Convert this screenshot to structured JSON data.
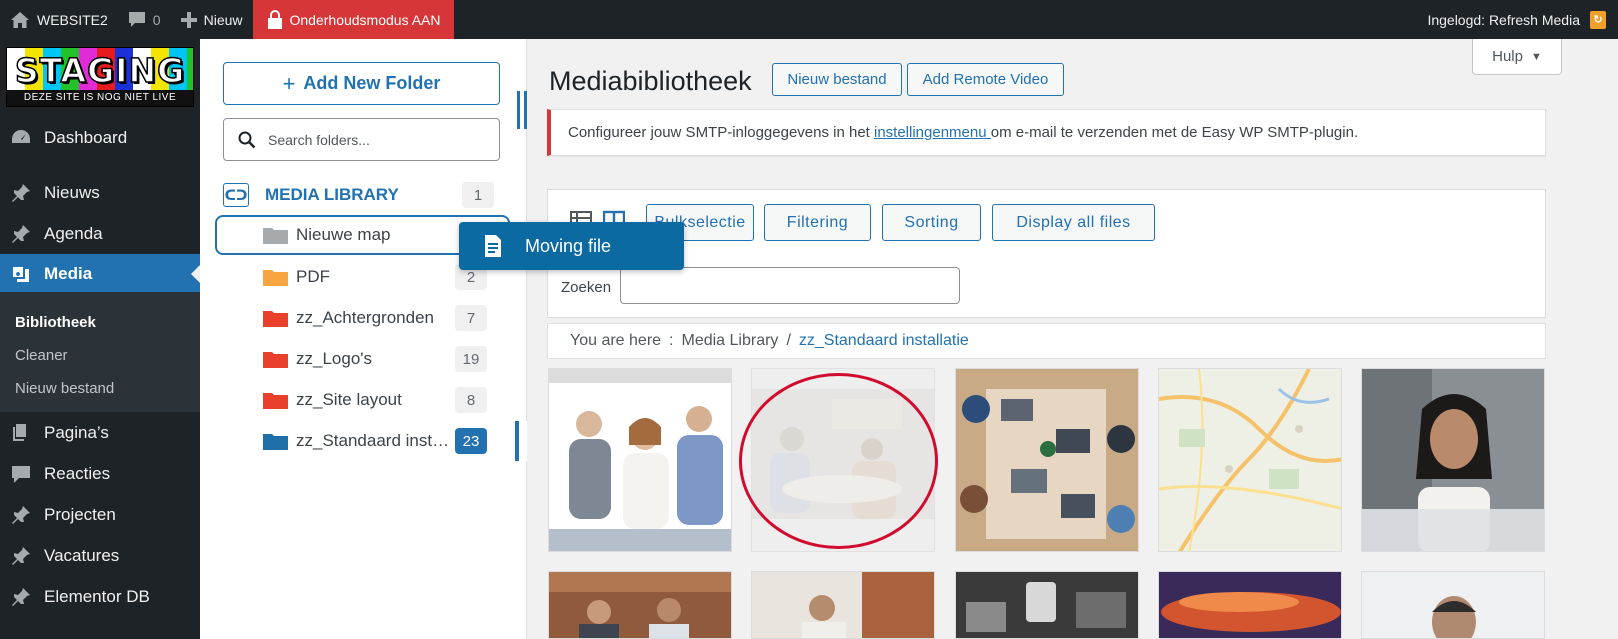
{
  "adminbar": {
    "site_name": "WEBSITE2",
    "comments_count": "0",
    "new_label": "Nieuw",
    "maintenance_label": "Onderhoudsmodus AAN",
    "logged_in_label": "Ingelogd: Refresh Media"
  },
  "sidebar": {
    "logo_top": "STAGING",
    "logo_bottom": "DEZE SITE IS NOG NIET LIVE",
    "items": [
      {
        "label": "Dashboard"
      },
      {
        "label": "Nieuws"
      },
      {
        "label": "Agenda"
      },
      {
        "label": "Media"
      },
      {
        "label": "Pagina’s"
      },
      {
        "label": "Reacties"
      },
      {
        "label": "Projecten"
      },
      {
        "label": "Vacatures"
      },
      {
        "label": "Elementor DB"
      }
    ],
    "submenu": [
      {
        "label": "Bibliotheek"
      },
      {
        "label": "Cleaner"
      },
      {
        "label": "Nieuw bestand"
      }
    ]
  },
  "folders": {
    "add_button": "Add New Folder",
    "search_placeholder": "Search folders...",
    "library_label": "MEDIA LIBRARY",
    "library_count": "1",
    "items": [
      {
        "name": "Nieuwe map",
        "count": "",
        "color": "#a7aaad"
      },
      {
        "name": "PDF",
        "count": "2",
        "color": "#f7a541"
      },
      {
        "name": "zz_Achtergronden",
        "count": "7",
        "color": "#e8402a"
      },
      {
        "name": "zz_Logo's",
        "count": "19",
        "color": "#e8402a"
      },
      {
        "name": "zz_Site layout",
        "count": "8",
        "color": "#e8402a"
      },
      {
        "name": "zz_Standaard inst…",
        "count": "23",
        "color": "#1f6fa8"
      }
    ],
    "drag_tooltip": "Moving file"
  },
  "main": {
    "help_label": "Hulp",
    "title": "Mediabibliotheek",
    "new_file_button": "Nieuw bestand",
    "remote_video_button": "Add Remote Video",
    "notice_before": "Configureer jouw SMTP-inloggegevens in het ",
    "notice_link": "instellingenmenu ",
    "notice_after": "om e-mail te verzenden met de Easy WP SMTP-plugin.",
    "toolbar": {
      "bulk": "Bulkselectie",
      "filtering": "Filtering",
      "sorting": "Sorting",
      "display_all": "Display all files",
      "search_label": "Zoeken"
    },
    "breadcrumb": {
      "prefix": "You are here",
      "separator_1": ":",
      "root": "Media Library",
      "separator_2": "/",
      "current": "zz_Standaard installatie"
    }
  }
}
